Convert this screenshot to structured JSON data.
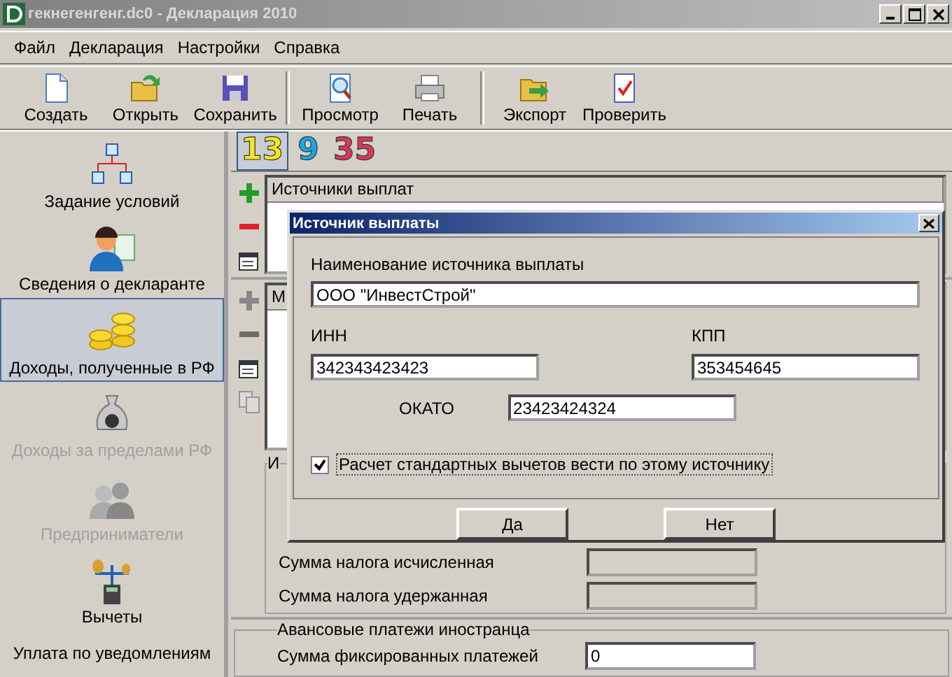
{
  "window": {
    "title": "гекнегенгенг.dc0 - Декларация 2010"
  },
  "menu": [
    "Файл",
    "Декларация",
    "Настройки",
    "Справка"
  ],
  "toolbar": [
    [
      "Создать",
      "Открыть",
      "Сохранить"
    ],
    [
      "Просмотр",
      "Печать"
    ],
    [
      "Экспорт",
      "Проверить"
    ]
  ],
  "sidebar": {
    "items": [
      {
        "label": "Задание условий",
        "selected": false,
        "disabled": false
      },
      {
        "label": "Сведения о декларанте",
        "selected": false,
        "disabled": false
      },
      {
        "label": "Доходы, полученные в РФ",
        "selected": true,
        "disabled": false
      },
      {
        "label": "Доходы за пределами РФ",
        "selected": false,
        "disabled": true
      },
      {
        "label": "Предприниматели",
        "selected": false,
        "disabled": true
      },
      {
        "label": "Вычеты",
        "selected": false,
        "disabled": false
      },
      {
        "label": "Уплата по уведомлениям",
        "selected": false,
        "disabled": false
      }
    ]
  },
  "rate_tabs": [
    {
      "label": "13",
      "selected": true,
      "color": "#f4e81c"
    },
    {
      "label": "9",
      "selected": false,
      "color": "#18a8e0"
    },
    {
      "label": "35",
      "selected": false,
      "color": "#d83a5a"
    }
  ],
  "sources_list": {
    "columns": [
      "Источники выплат"
    ],
    "tools": [
      {
        "kind": "add",
        "disabled": false
      },
      {
        "kind": "remove",
        "disabled": false
      },
      {
        "kind": "properties",
        "disabled": false
      }
    ]
  },
  "income_list": {
    "columns": [
      "М"
    ],
    "tools": [
      {
        "kind": "add",
        "disabled": true
      },
      {
        "kind": "remove",
        "disabled": true
      },
      {
        "kind": "properties",
        "disabled": false
      },
      {
        "kind": "copy",
        "disabled": true
      }
    ]
  },
  "tax_group": {
    "legend": "И",
    "fields": [
      {
        "label": "Сумма налога исчисленная",
        "disabled": true
      },
      {
        "label": "Сумма налога удержанная",
        "disabled": true
      }
    ]
  },
  "advance_group": {
    "legend": "Авансовые платежи иностранца",
    "fields": [
      {
        "label": "Сумма фиксированных платежей",
        "value": "0",
        "disabled": false
      }
    ]
  },
  "dialog": {
    "title": "Источник выплаты",
    "name_label": "Наименование источника выплаты",
    "name_value": "ООО \"ИнвестСтрой\"",
    "inn_label": "ИНН",
    "inn_value": "342343423423",
    "kpp_label": "КПП",
    "kpp_value": "353454645",
    "okato_label": "ОКАТО",
    "okato_value": "23423424324",
    "standard_deductions": {
      "label": "Расчет стандартных вычетов вести по этому источнику",
      "checked": true
    },
    "buttons": [
      "Да",
      "Нет"
    ]
  }
}
